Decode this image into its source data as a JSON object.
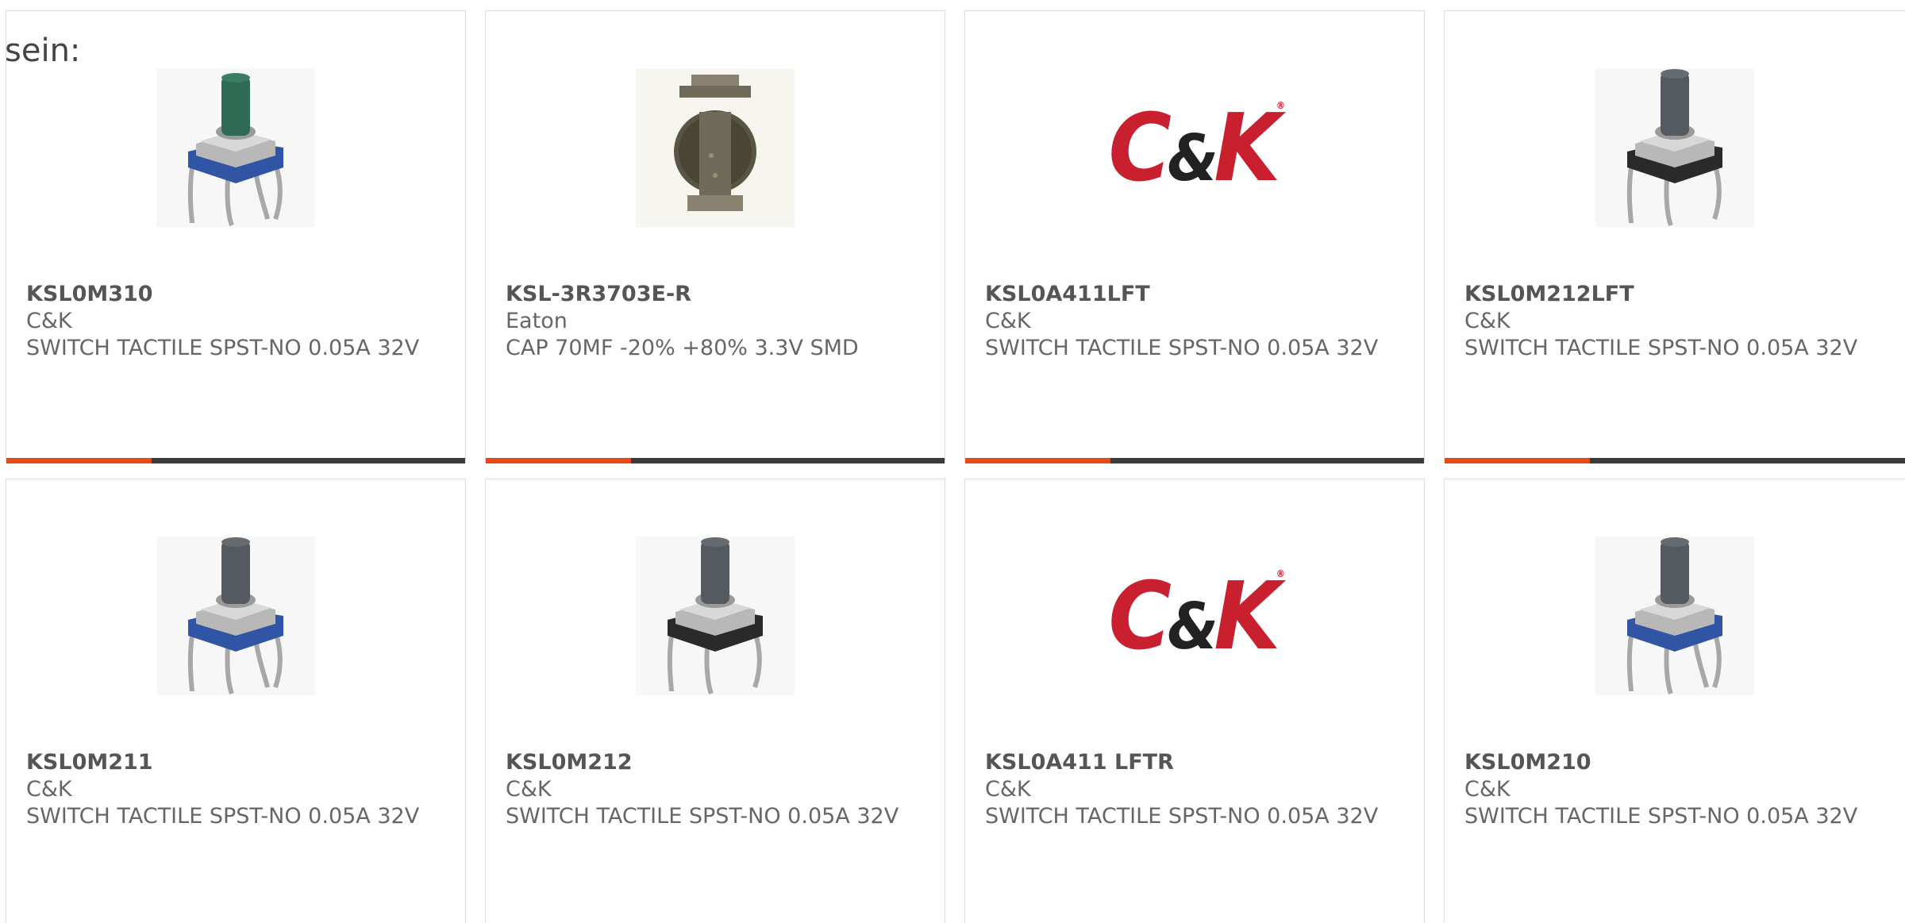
{
  "intro_text": "sein:",
  "colors": {
    "accent": "#e64a19",
    "bar": "#3c3c3c",
    "ck_red": "#c8202f"
  },
  "products": [
    {
      "mpn": "KSL0M310",
      "manufacturer": "C&K",
      "description": "SWITCH TACTILE SPST-NO 0.05A 32V",
      "image": "tactile-switch-green"
    },
    {
      "mpn": "KSL-3R3703E-R",
      "manufacturer": "Eaton",
      "description": "CAP 70MF -20% +80% 3.3V SMD",
      "image": "supercap-coin"
    },
    {
      "mpn": "KSL0A411LFT",
      "manufacturer": "C&K",
      "description": "SWITCH TACTILE SPST-NO 0.05A 32V",
      "image": "ck-logo"
    },
    {
      "mpn": "KSL0M212LFT",
      "manufacturer": "C&K",
      "description": "SWITCH TACTILE SPST-NO 0.05A 32V",
      "image": "tactile-switch-gray-black"
    },
    {
      "mpn": "KSL0M211",
      "manufacturer": "C&K",
      "description": "SWITCH TACTILE SPST-NO 0.05A 32V",
      "image": "tactile-switch-gray-blue"
    },
    {
      "mpn": "KSL0M212",
      "manufacturer": "C&K",
      "description": "SWITCH TACTILE SPST-NO 0.05A 32V",
      "image": "tactile-switch-gray-black"
    },
    {
      "mpn": "KSL0A411 LFTR",
      "manufacturer": "C&K",
      "description": "SWITCH TACTILE SPST-NO 0.05A 32V",
      "image": "ck-logo"
    },
    {
      "mpn": "KSL0M210",
      "manufacturer": "C&K",
      "description": "SWITCH TACTILE SPST-NO 0.05A 32V",
      "image": "tactile-switch-gray-blue"
    }
  ],
  "logo": {
    "c": "C",
    "amp": "&",
    "k": "K",
    "reg": "®"
  }
}
